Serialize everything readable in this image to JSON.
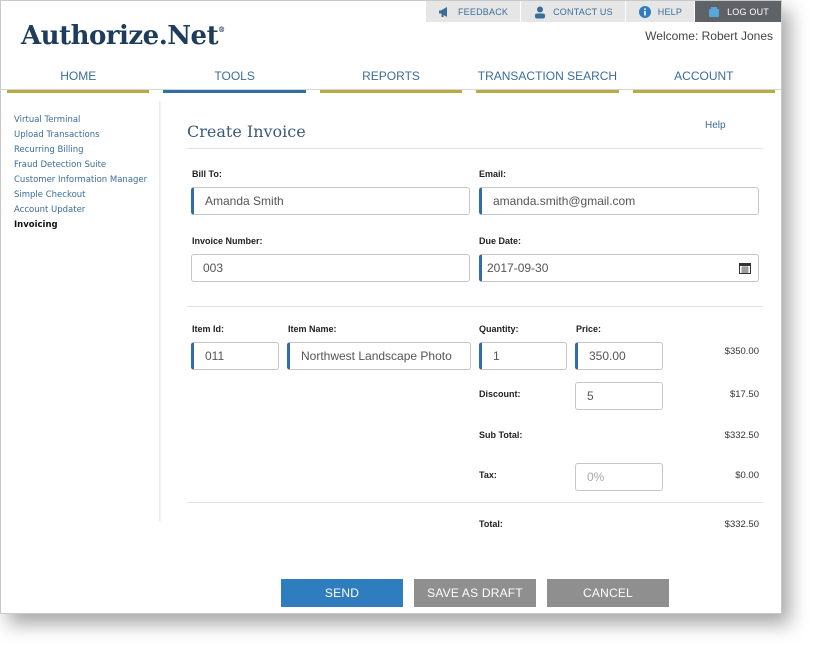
{
  "topbar": {
    "feedback": "FEEDBACK",
    "contact": "CONTACT US",
    "help": "HELP",
    "logout": "LOG OUT"
  },
  "brand": {
    "logo": "Authorize.Net",
    "trademark": "®"
  },
  "welcome": "Welcome: Robert Jones",
  "nav": [
    {
      "label": "HOME"
    },
    {
      "label": "TOOLS"
    },
    {
      "label": "REPORTS"
    },
    {
      "label": "TRANSACTION SEARCH"
    },
    {
      "label": "ACCOUNT"
    }
  ],
  "sidebar": [
    {
      "label": "Virtual Terminal"
    },
    {
      "label": "Upload Transactions"
    },
    {
      "label": "Recurring Billing"
    },
    {
      "label": "Fraud Detection Suite"
    },
    {
      "label": "Customer Information Manager"
    },
    {
      "label": "Simple Checkout"
    },
    {
      "label": "Account Updater"
    },
    {
      "label": "Invoicing"
    }
  ],
  "main": {
    "title": "Create Invoice",
    "help": "Help",
    "bill_to": {
      "label": "Bill To:",
      "value": "Amanda Smith"
    },
    "email": {
      "label": "Email:",
      "value": "amanda.smith@gmail.com"
    },
    "invoice_number": {
      "label": "Invoice Number:",
      "value": "003"
    },
    "due_date": {
      "label": "Due Date:",
      "value": "2017-09-30"
    },
    "item": {
      "id_label": "Item Id:",
      "id_value": "011",
      "name_label": "Item Name:",
      "name_value": "Northwest Landscape Photo",
      "qty_label": "Quantity:",
      "qty_value": "1",
      "price_label": "Price:",
      "price_value": "350.00",
      "line_total": "$350.00"
    },
    "discount": {
      "label": "Discount:",
      "value": "5",
      "amount": "$17.50"
    },
    "subtotal": {
      "label": "Sub Total:",
      "amount": "$332.50"
    },
    "tax": {
      "label": "Tax:",
      "placeholder": "0%",
      "amount": "$0.00"
    },
    "total": {
      "label": "Total:",
      "amount": "$332.50"
    }
  },
  "actions": {
    "send": "SEND",
    "draft": "SAVE AS DRAFT",
    "cancel": "CANCEL"
  },
  "colors": {
    "brand_navy": "#1e3c5c",
    "link_blue": "#3a6d99",
    "nav_gold": "#b8ab44",
    "nav_active": "#2f6fa4",
    "send_blue": "#2f7dbf",
    "button_gray": "#8f8f8f"
  }
}
